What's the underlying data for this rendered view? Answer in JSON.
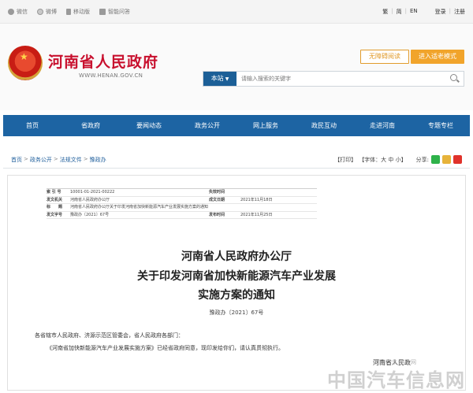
{
  "topbar": {
    "links": [
      {
        "label": "微信",
        "icon": "wechat-icon"
      },
      {
        "label": "微博",
        "icon": "weibo-icon"
      },
      {
        "label": "移动版",
        "icon": "mobile-icon"
      },
      {
        "label": "智能问答",
        "icon": "qa-icon"
      }
    ],
    "lang": [
      "繁",
      "简",
      "EN"
    ],
    "account": [
      "登录",
      "注册"
    ]
  },
  "header": {
    "title": "河南省人民政府",
    "url": "WWW.HENAN.GOV.CN",
    "barrier_free": "无障碍阅读",
    "elder_mode": "进入适老模式",
    "search_scope": "本站",
    "search_placeholder": "请输入搜索的关键字"
  },
  "nav": [
    "首页",
    "省政府",
    "要闻动态",
    "政务公开",
    "网上服务",
    "政民互动",
    "走进河南",
    "专题专栏"
  ],
  "crumbs": [
    "首页",
    "政务公开",
    "法规文件",
    "豫政办"
  ],
  "tools": {
    "print": "【打印】",
    "font": "【字体：大 中 小】",
    "share": "分享:"
  },
  "meta": {
    "rows": [
      {
        "k": "索 引 号",
        "v": "10001-01-2021-00222",
        "k2": "失效时间",
        "v2": ""
      },
      {
        "k": "发文机关",
        "v": "河南省人民政府办公厅",
        "k2": "成文日期",
        "v2": "2021年11月18日"
      },
      {
        "k": "标　　题",
        "v": "河南省人民政府办公厅关于印发河南省加快新能源汽车产业发展实施方案的通知",
        "k2": "",
        "v2": ""
      },
      {
        "k": "发文字号",
        "v": "豫政办〔2021〕67号",
        "k2": "发布时间",
        "v2": "2021年11月25日"
      }
    ]
  },
  "document": {
    "title_lines": [
      "河南省人民政府办公厅",
      "关于印发河南省加快新能源汽车产业发展",
      "实施方案的通知"
    ],
    "doc_no": "豫政办〔2021〕67号",
    "salutation": "各省辖市人民政府、济源示范区管委会，省人民政府各部门：",
    "body": "《河南省加快新能源汽车产业发展实施方案》已经省政府同意，现印发给你们，请认真贯彻执行。",
    "issuer": "河南省人民政"
  },
  "watermark": {
    "main": "中国汽车信息网",
    "sub": "中国汽车信息网"
  },
  "colors": {
    "brand_red": "#c8102e",
    "nav_blue": "#1d64a3",
    "accent_orange": "#f1a42b"
  }
}
